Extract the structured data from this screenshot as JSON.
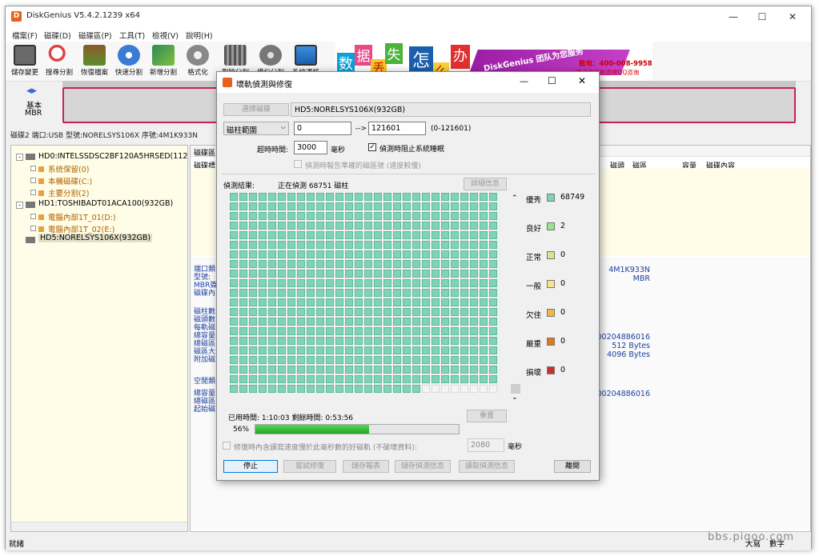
{
  "app": {
    "title": "DiskGenius V5.4.2.1239 x64",
    "min": "—",
    "max": "☐",
    "close": "✕"
  },
  "menu": [
    "檔案(F)",
    "磁碟(D)",
    "磁碟區(P)",
    "工具(T)",
    "檢視(V)",
    "說明(H)"
  ],
  "toolbar": [
    "儲存變更",
    "搜尋分割",
    "恢復檔案",
    "快速分割",
    "新增分割",
    "格式化",
    "刪除分割",
    "備份分割",
    "系統遷移"
  ],
  "banner": {
    "chars": [
      "数",
      "据",
      "丢",
      "失",
      "怎",
      "么",
      "办"
    ],
    "slogan": "DiskGenius 团队为您服务",
    "phone": "致电：400-008-9958",
    "qq": "或点击此处选择QQ咨询"
  },
  "diskmap": {
    "type": "基本",
    "scheme": "MBR"
  },
  "diskinfo": "磁碟2 端口:USB  型號:NORELSYS106X  序號:4M1K933N",
  "tree": [
    {
      "label": "HD0:INTELSSDSC2BF120A5HRSED(112",
      "color": "#000"
    },
    {
      "label": "系统保留(0)",
      "color": "#b06000"
    },
    {
      "label": "本機磁碟(C:)",
      "color": "#b06000"
    },
    {
      "label": "主要分割(2)",
      "color": "#b06000"
    },
    {
      "label": "HD1:TOSHIBADT01ACA100(932GB)",
      "color": "#000"
    },
    {
      "label": "電腦內部1T_01(D:)",
      "color": "#b06000"
    },
    {
      "label": "電腦內部1T_02(E:)",
      "color": "#b06000"
    },
    {
      "label": "HD5:NORELSYS106X(932GB)",
      "color": "#000"
    }
  ],
  "right": {
    "tab": "磁碟區",
    "col0": "磁碟標",
    "cols": [
      "磁頭",
      "磁區",
      "容量",
      "磁碟內容"
    ],
    "labels1": [
      "端口類",
      "型號:",
      "MBR簽",
      "磁碟內"
    ],
    "labels2": [
      "磁柱數",
      "磁頭數",
      "每軌磁",
      "總容量",
      "總磁區",
      "磁區大",
      "附加磁"
    ],
    "labels3": [
      "空閒類"
    ],
    "labels4": [
      "總容量",
      "總磁區",
      "起始磁"
    ],
    "vals1": [
      "4M1K933N",
      "MBR"
    ],
    "vals2": [
      "00204886016",
      "512 Bytes",
      "4096 Bytes"
    ],
    "vals3": [
      "00204886016"
    ]
  },
  "dialog": {
    "title": "壞軌偵測與修復",
    "select_disk": "選擇磁碟",
    "disk": "HD5:NORELSYS106X(932GB)",
    "range_label": "磁柱範圍",
    "from": "0",
    "arrow": "-->",
    "to": "121601",
    "range_hint": "(0-121601)",
    "timeout_label": "超時時間:",
    "timeout": "3000",
    "ms": "毫秒",
    "stop_sleep": "偵測時阻止系統睡眠",
    "report_note": "偵測時報告準確的磁區號 (速度較慢)",
    "result_label": "偵測結果:",
    "status": "正在偵測 68751 磁柱",
    "detail": "詳細信息",
    "elapsed": "已用時間: 1:10:03  剩餘時間: 0:53:56",
    "reset": "重置",
    "percent": "56%",
    "progress": 0.56,
    "repair_opt": "修復時內含讀寫速度慢於此毫秒數的好磁軌 (不破壞資料):",
    "repair_ms": "2080",
    "repair_unit": "毫秒",
    "buttons": [
      "停止",
      "嘗試修復",
      "儲存報表",
      "儲存偵測信息",
      "讀取偵測信息",
      "離開"
    ]
  },
  "legend": [
    {
      "label": "優秀",
      "color": "#7fd3b6",
      "count": "68749"
    },
    {
      "label": "良好",
      "color": "#9be28f",
      "count": "2"
    },
    {
      "label": "正常",
      "color": "#d7e68c",
      "count": "0"
    },
    {
      "label": "一般",
      "color": "#f7e58e",
      "count": "0"
    },
    {
      "label": "欠佳",
      "color": "#f0b840",
      "count": "0"
    },
    {
      "label": "嚴重",
      "color": "#e07820",
      "count": "0"
    },
    {
      "label": "損壞",
      "color": "#c83030",
      "count": "0"
    }
  ],
  "status": {
    "left": "就緒",
    "r1": "大寫",
    "r2": "數字"
  },
  "watermark": "bbs.pigoo.com"
}
